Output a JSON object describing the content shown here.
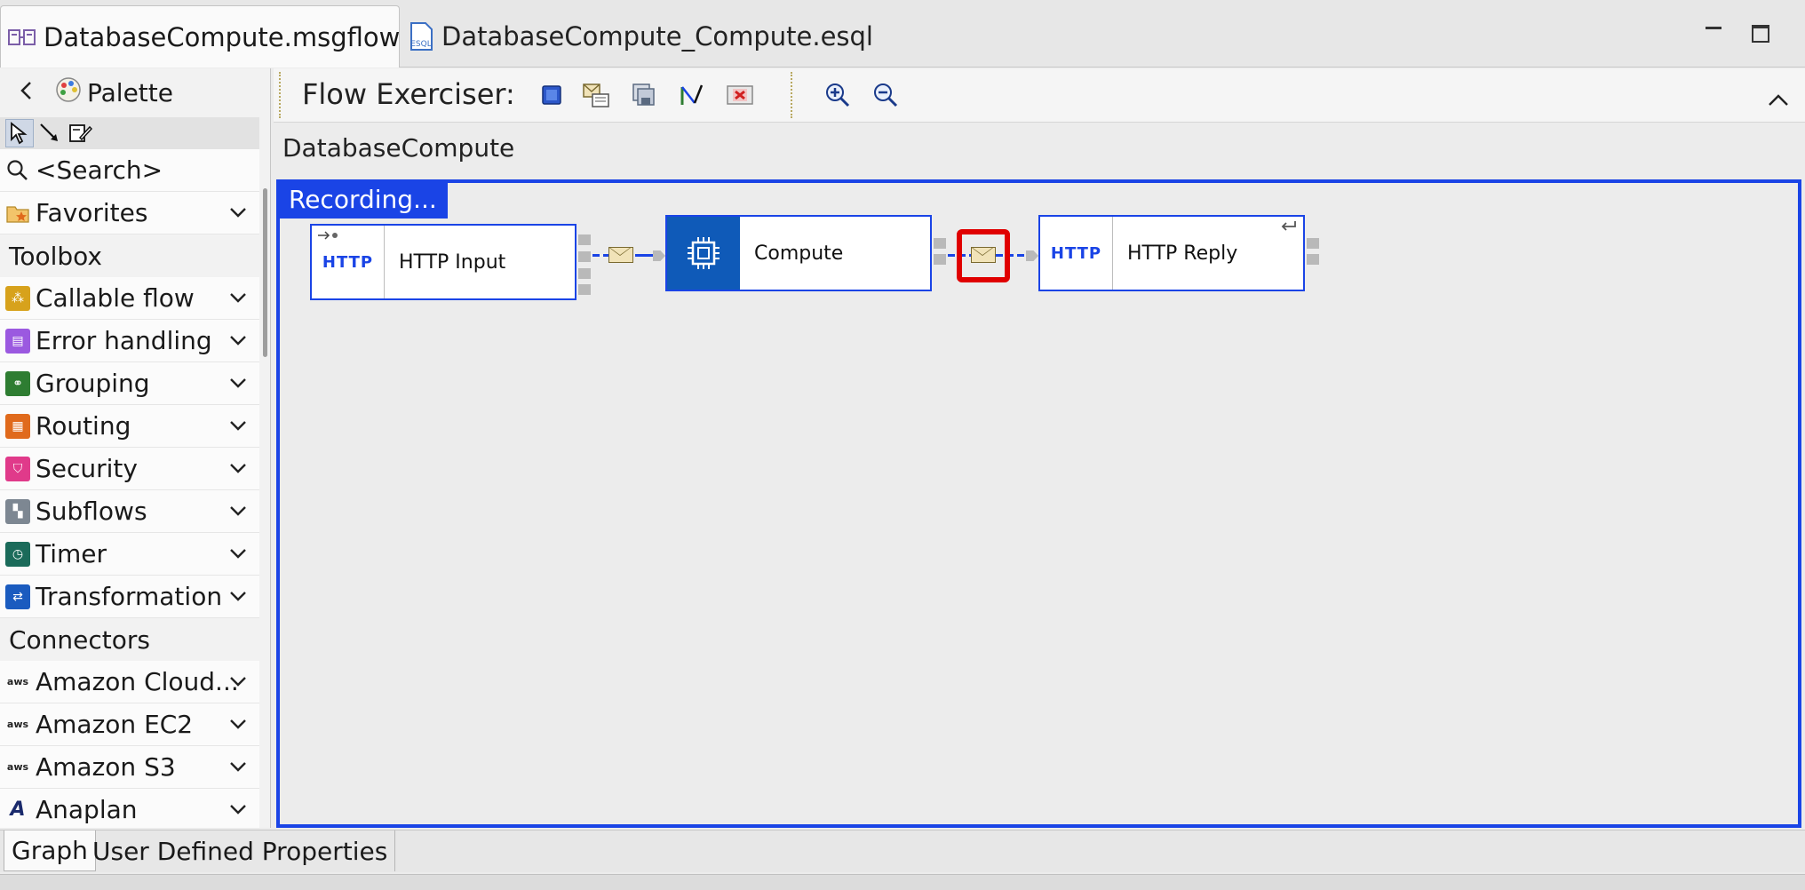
{
  "tabs": {
    "active": {
      "label": "DatabaseCompute.msgflow",
      "close": "⊠"
    },
    "other": {
      "label": "DatabaseCompute_Compute.esql",
      "icon_text": "ESQL"
    }
  },
  "palette": {
    "title": "Palette",
    "search_placeholder": "<Search>",
    "favorites": "Favorites",
    "toolbox_heading": "Toolbox",
    "toolbox_items": [
      {
        "label": "Callable flow",
        "color": "#d7a21c"
      },
      {
        "label": "Error handling",
        "color": "#9b59e0"
      },
      {
        "label": "Grouping",
        "color": "#2e7d32"
      },
      {
        "label": "Routing",
        "color": "#e06a1c"
      },
      {
        "label": "Security",
        "color": "#e03a8a"
      },
      {
        "label": "Subflows",
        "color": "#7d8792"
      },
      {
        "label": "Timer",
        "color": "#1b6b5a"
      },
      {
        "label": "Transformation",
        "color": "#1a5bbf"
      }
    ],
    "connectors_heading": "Connectors",
    "connector_items": [
      {
        "label": "Amazon Cloud...",
        "icon_text": "aws"
      },
      {
        "label": "Amazon EC2",
        "icon_text": "aws"
      },
      {
        "label": "Amazon S3",
        "icon_text": "aws"
      },
      {
        "label": "Anaplan",
        "icon_text": "A"
      }
    ]
  },
  "exerciser": {
    "label": "Flow Exerciser:"
  },
  "breadcrumb": "DatabaseCompute",
  "canvas": {
    "recording_label": "Recording...",
    "nodes": {
      "http_input": {
        "label": "HTTP Input",
        "icon_text": "HTTP"
      },
      "compute": {
        "label": "Compute"
      },
      "http_reply": {
        "label": "HTTP Reply",
        "icon_text": "HTTP"
      }
    }
  },
  "bottom_tabs": {
    "graph": "Graph",
    "udp": "User Defined Properties"
  },
  "colors": {
    "accent": "#1a44e6",
    "highlight": "#e00000",
    "compute_fill": "#0f5ab8"
  }
}
